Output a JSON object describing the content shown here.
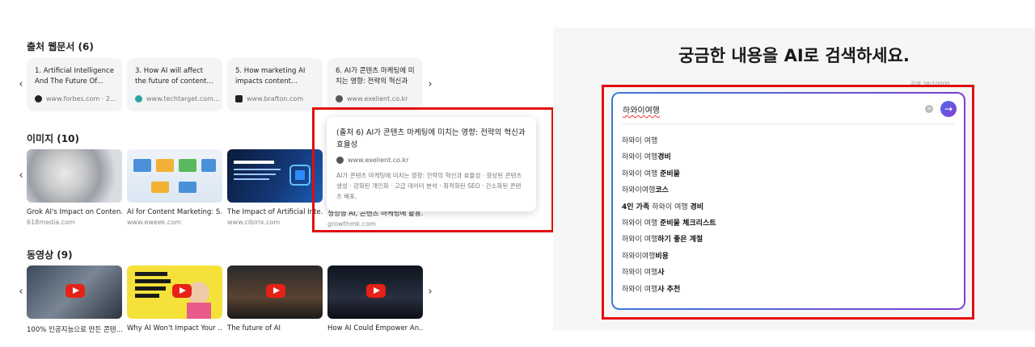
{
  "sources": {
    "title": "출처 웹문서 (6)",
    "cards": [
      {
        "title": "1. Artificial Intelligence And The Future Of...",
        "domain": "www.forbes.com · 2...",
        "fav_color": "#222222"
      },
      {
        "title": "3. How AI will affect the future of content...",
        "domain": "www.techtarget.com...",
        "fav_color": "#2aa7a1"
      },
      {
        "title": "5. How marketing AI impacts content...",
        "domain": "www.brafton.com",
        "fav_color": "#222222"
      },
      {
        "title": "6. AI가 콘텐츠 마케팅에 미치는 영향: 전략의 혁신과 ...",
        "domain": "www.exelient.co.kr",
        "fav_color": "#555555"
      }
    ]
  },
  "popup": {
    "title": "(출처 6) AI가 콘텐츠 마케팅에 미치는 영향: 전략의 혁신과 효율성",
    "domain": "www.exelient.co.kr",
    "body": "AI가 콘텐츠 마케팅에 미치는 영향: 전략의 혁신과 효율성 · 향상된 콘텐츠 생성 · 강화된 개인화 · 고급 데이터 분석 · 최적화된 SEO · 간소화된 콘텐츠 배포."
  },
  "images": {
    "title": "이미지 (10)",
    "cards": [
      {
        "caption": "Grok AI's Impact on Conten...",
        "domain": "618media.com"
      },
      {
        "caption": "AI for Content Marketing: S...",
        "domain": "www.eweek.com"
      },
      {
        "caption": "The Impact of Artificial Inte...",
        "domain": "www.cibirix.com"
      },
      {
        "caption": "생성형 AI, 콘텐츠 마케팅에 활용...",
        "domain": "growthmk.com"
      }
    ]
  },
  "videos": {
    "title": "동영상 (9)",
    "cards": [
      {
        "caption": "100% 인공지능으로 만든 콘텐..."
      },
      {
        "caption": "Why AI Won't Impact Your ..."
      },
      {
        "caption": "The future of AI"
      },
      {
        "caption": "How AI Could Empower An..."
      }
    ]
  },
  "search": {
    "headline": "궁금한 내용을 AI로 검색하세요.",
    "counter": "검색 38/10000",
    "query": "하와이여행",
    "suggestions": [
      {
        "base": "하와이 여행",
        "bold": ""
      },
      {
        "base": "하와이 여행",
        "bold": "경비"
      },
      {
        "base": "하와이 여행 ",
        "bold": "준비물"
      },
      {
        "base": "하와이여행",
        "bold": "코스"
      },
      {
        "pre": "4인 가족 ",
        "base": "하와이 여행 ",
        "bold": "경비"
      },
      {
        "base": "하와이 여행 ",
        "bold": "준비물 체크리스트"
      },
      {
        "base": "하와이 여행",
        "bold": "하기 좋은 계절"
      },
      {
        "base": "하와이여행",
        "bold": "비용"
      },
      {
        "base": "하와이 여행",
        "bold": "사"
      },
      {
        "base": "하와이 여행",
        "bold": "사 추천"
      }
    ]
  },
  "colors": {
    "highlight": "#e40d0d",
    "accent_start": "#3b7bd6",
    "accent_end": "#7b3fd0"
  }
}
